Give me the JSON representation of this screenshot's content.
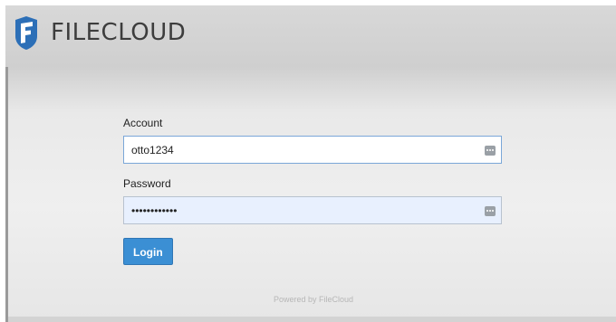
{
  "app": {
    "brand_name": "FILECLOUD"
  },
  "login_form": {
    "account_label": "Account",
    "account_value": "otto1234",
    "password_label": "Password",
    "password_value": "••••••••••••",
    "login_button": "Login"
  },
  "footer": {
    "powered_by": "Powered by FileCloud"
  },
  "colors": {
    "primary_button": "#3b8fd4",
    "logo_blue": "#2c6fb7"
  },
  "icons": [
    "filecloud-logo-icon",
    "key-icon",
    "key-icon"
  ]
}
